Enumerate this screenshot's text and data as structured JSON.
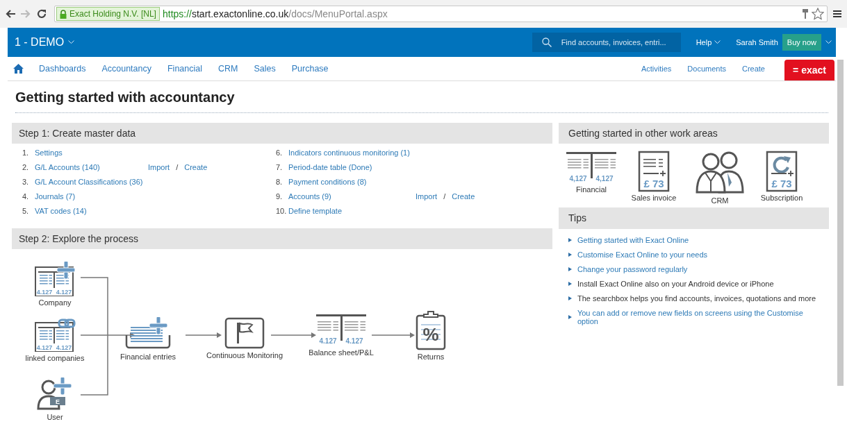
{
  "browser": {
    "can_go_back": true,
    "can_go_forward": false,
    "certificate": "Exact Holding N.V. [NL]",
    "url": {
      "scheme": "https://",
      "host": "start.exactonline.co.uk",
      "path": "/docs/MenuPortal.aspx"
    }
  },
  "header": {
    "company": "1 - DEMO",
    "search": {
      "placeholder": "Find accounts, invoices, entri..."
    },
    "help": "Help",
    "user": "Sarah Smith",
    "buy_button": "Buy now"
  },
  "nav": {
    "items": [
      "Dashboards",
      "Accountancy",
      "Financial",
      "CRM",
      "Sales",
      "Purchase"
    ],
    "right_items": [
      "Activities",
      "Documents",
      "Create"
    ],
    "logo": "= exact"
  },
  "page_title": "Getting started with accountancy",
  "step1": {
    "title": "Step 1: Create master data",
    "action_separator": "/",
    "columns": [
      [
        {
          "number": "1.",
          "label": "Settings"
        },
        {
          "number": "2.",
          "label": "G/L Accounts (140)",
          "actions": [
            "Import",
            "Create"
          ]
        },
        {
          "number": "3.",
          "label": "G/L Account Classifications (36)"
        },
        {
          "number": "4.",
          "label": "Journals (7)"
        },
        {
          "number": "5.",
          "label": "VAT codes (14)"
        }
      ],
      [
        {
          "number": "6.",
          "label": "Indicators continuous monitoring (1)"
        },
        {
          "number": "7.",
          "label": "Period-date table (Done)"
        },
        {
          "number": "8.",
          "label": "Payment conditions (8)"
        },
        {
          "number": "9.",
          "label": "Accounts (9)",
          "actions": [
            "Import",
            "Create"
          ]
        },
        {
          "number": "10.",
          "label": "Define template"
        }
      ]
    ]
  },
  "step2": {
    "title": "Step 2: Explore the process",
    "inputs": [
      {
        "kind": "company",
        "label": "Company",
        "figures": [
          "4.127",
          "4.127"
        ]
      },
      {
        "kind": "linked",
        "label": "linked companies",
        "figures": [
          "4.127",
          "4.127"
        ]
      },
      {
        "kind": "user",
        "label": "User",
        "figures": [
          "E"
        ]
      }
    ],
    "steps": [
      {
        "kind": "entries",
        "label": "Financial entries"
      },
      {
        "kind": "monitoring",
        "label": "Continuous Monitoring"
      },
      {
        "kind": "balance",
        "label": "Balance sheet/P&L",
        "figures": [
          "4.127",
          "4.127"
        ]
      },
      {
        "kind": "returns",
        "label": "Returns",
        "figures": [
          "%"
        ]
      }
    ]
  },
  "work_areas": {
    "title": "Getting started in other work areas",
    "items": [
      {
        "kind": "financial",
        "label": "Financial",
        "figures": [
          "4,127",
          "4,127"
        ]
      },
      {
        "kind": "invoice",
        "label": "Sales invoice",
        "figures": [
          "£ 73"
        ]
      },
      {
        "kind": "crm",
        "label": "CRM"
      },
      {
        "kind": "subscription",
        "label": "Subscription",
        "figures": [
          "£ 73"
        ]
      }
    ]
  },
  "tips": {
    "title": "Tips",
    "items": [
      {
        "kind": "link",
        "text": "Getting started with Exact Online"
      },
      {
        "kind": "link",
        "text": "Customise Exact Online to your needs"
      },
      {
        "kind": "link",
        "text": "Change your password regularly"
      },
      {
        "kind": "text",
        "text": "Install Exact Online also on your Android device or iPhone"
      },
      {
        "kind": "text",
        "text": "The searchbox helps you find accounts, invoices, quotations and more"
      },
      {
        "kind": "link",
        "text": "You can add or remove new fields on screens using the Customise option"
      }
    ]
  }
}
